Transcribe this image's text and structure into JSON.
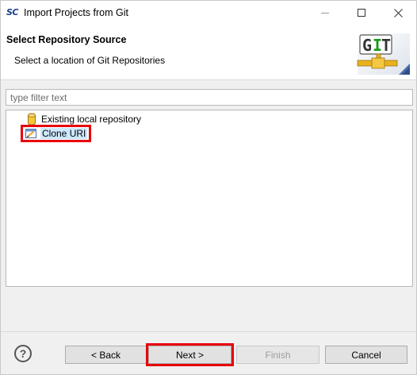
{
  "window": {
    "logo": "SC",
    "title": "Import Projects from Git",
    "controls": {
      "minimize": "minimize-icon",
      "maximize": "maximize-icon",
      "close": "close-icon"
    }
  },
  "header": {
    "title": "Select Repository Source",
    "description": "Select a location of Git Repositories",
    "banner_text": "GIT"
  },
  "filter": {
    "placeholder": "type filter text",
    "value": ""
  },
  "tree": {
    "items": [
      {
        "label": "Existing local repository",
        "icon": "repository-icon"
      },
      {
        "label": "Clone URI",
        "icon": "clone-uri-icon",
        "selected": true
      }
    ]
  },
  "buttons": {
    "help": "?",
    "back": "< Back",
    "next": "Next >",
    "finish": "Finish",
    "cancel": "Cancel"
  },
  "colors": {
    "highlight": "#e8000b",
    "selection": "#cce8ff",
    "git_green": "#1a9a1a",
    "git_gold": "#e8b21f"
  }
}
